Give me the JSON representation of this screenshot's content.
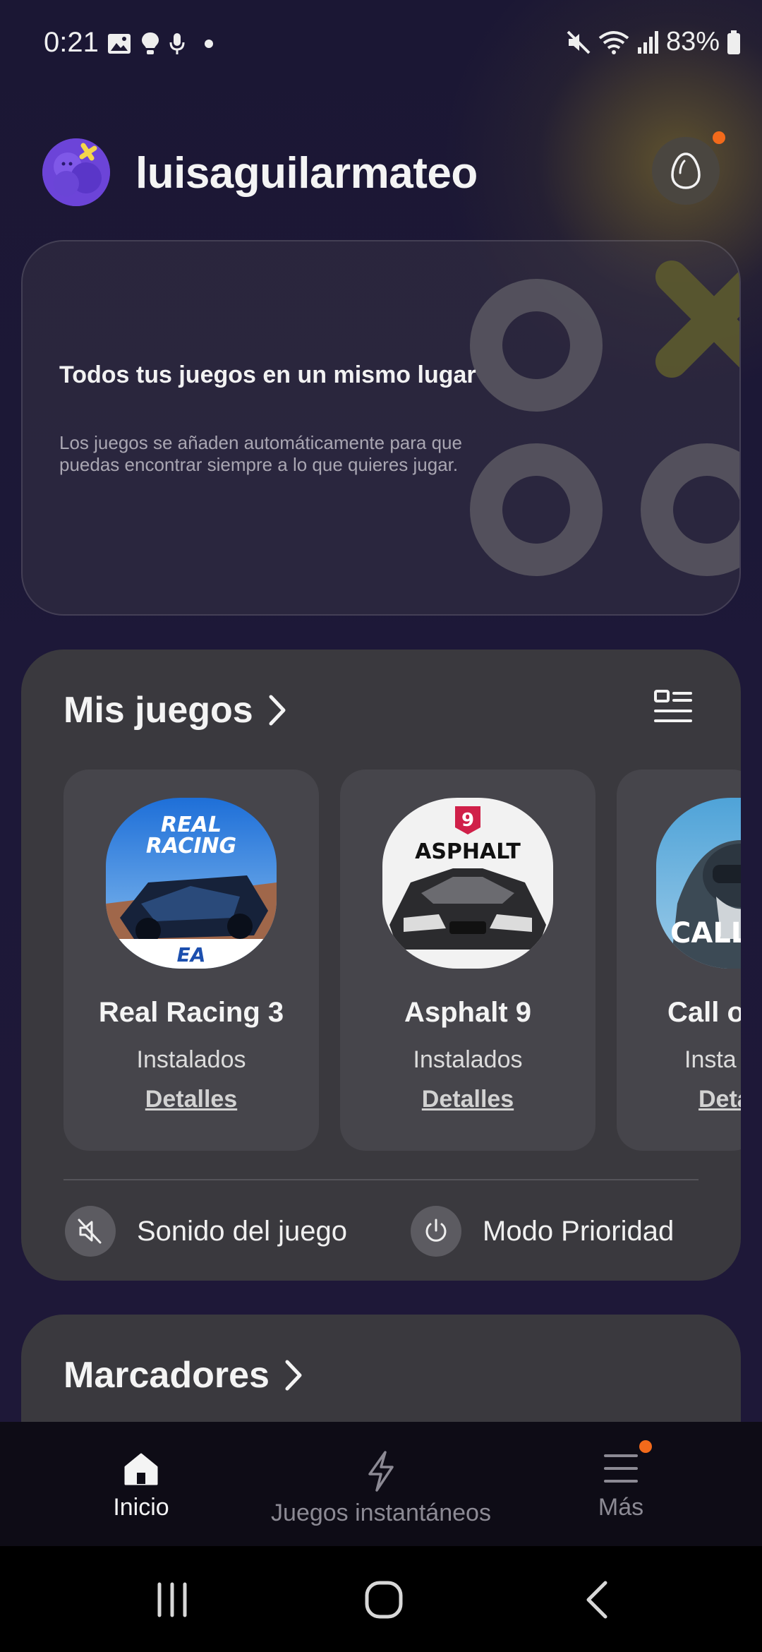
{
  "status_bar": {
    "time": "0:21",
    "battery": "83%",
    "left_icons": [
      "gallery-icon",
      "lightbulb-icon",
      "mic-icon",
      "dot-icon"
    ],
    "right_icons": [
      "mute-icon",
      "wifi-icon",
      "signal-icon",
      "battery-icon"
    ]
  },
  "header": {
    "username": "luisaguilarmateo",
    "egg_button_icon": "egg-icon",
    "has_notification": true
  },
  "hero": {
    "title": "Todos tus juegos en un mismo lugar",
    "subtitle": "Los juegos se añaden automáticamente para que puedas encontrar siempre a lo que quieres jugar."
  },
  "games_section": {
    "title": "Mis juegos",
    "games": [
      {
        "name": "Real Racing 3",
        "status": "Instalados",
        "details": "Detalles",
        "icon_text": "REAL RACING",
        "icon_sub": "EA"
      },
      {
        "name": "Asphalt 9",
        "status": "Instalados",
        "details": "Detalles",
        "icon_text": "ASPHALT",
        "icon_badge": "9"
      },
      {
        "name": "Call o",
        "status": "Insta",
        "details": "Deta",
        "icon_text": "CALL OF"
      }
    ],
    "quick_actions": [
      {
        "label": "Sonido del juego",
        "icon": "mute-sound-icon"
      },
      {
        "label": "Modo Prioridad",
        "icon": "power-icon"
      }
    ]
  },
  "marcadores": {
    "title": "Marcadores"
  },
  "bottom_nav": {
    "items": [
      {
        "label": "Inicio",
        "icon": "home-icon",
        "active": true
      },
      {
        "label": "Juegos instantáneos",
        "icon": "lightning-icon",
        "active": false
      },
      {
        "label": "Más",
        "icon": "menu-icon",
        "active": false,
        "has_notification": true
      }
    ]
  },
  "colors": {
    "background": "#1c1833",
    "card": "#3a393e",
    "tile": "#46454b",
    "notification": "#f26a1b"
  }
}
